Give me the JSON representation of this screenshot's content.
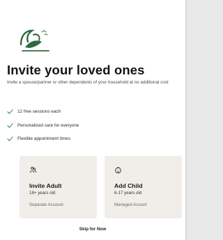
{
  "header": {
    "logo_icon": "bird-logo-icon",
    "title": "Invite your loved ones",
    "subtitle": "Invite a spouse/partner or other dependents of your household at no additional cost"
  },
  "benefits": [
    {
      "icon": "check-icon",
      "label": "12 free sessions each"
    },
    {
      "icon": "check-icon",
      "label": "Personalized care for everyone"
    },
    {
      "icon": "check-icon",
      "label": "Flexible appointment times"
    }
  ],
  "options": [
    {
      "icon": "adult-icon",
      "title": "Invite Adult",
      "age": "18+ years old",
      "account_type": "Separate Account"
    },
    {
      "icon": "child-icon",
      "title": "Add Child",
      "age": "6-17 years old",
      "account_type": "Managed Acount"
    }
  ],
  "footer": {
    "skip_label": "Skip for Now"
  },
  "colors": {
    "brand_green": "#2e6b3e",
    "check_green": "#2e8b57",
    "option_bg": "#f1eeea"
  }
}
